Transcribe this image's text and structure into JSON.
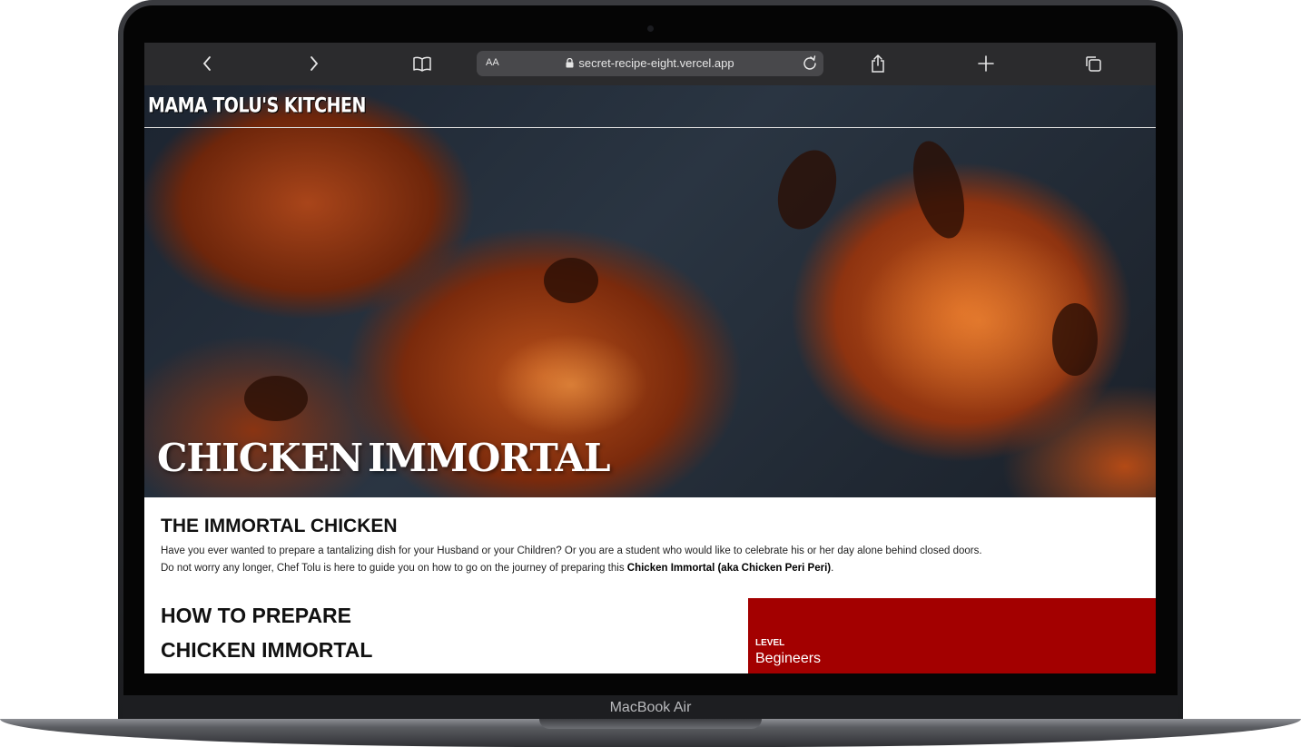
{
  "device": {
    "model_label": "MacBook Air"
  },
  "browser": {
    "text_size_label": "AA",
    "url": "secret-recipe-eight.vercel.app",
    "icons": [
      "back-icon",
      "forward-icon",
      "bookmarks-icon",
      "lock-icon",
      "reload-icon",
      "share-icon",
      "new-tab-icon",
      "tabs-icon"
    ]
  },
  "site": {
    "logo": "MAMA TOLU'S KITCHEN",
    "hero_title_word1": "CHICKEN",
    "hero_title_word2": "IMMORTAL"
  },
  "intro": {
    "heading": "THE IMMORTAL CHICKEN",
    "line1": "Have you ever wanted to prepare a tantalizing dish for your Husband or your Children? Or you are a student who would like to celebrate his or her day alone behind closed doors.",
    "line2": "Do not worry any longer, Chef Tolu is here to guide you on how to go on the journey of preparing this ",
    "highlight": "Chicken Immortal (aka Chicken Peri Peri)",
    "period": "."
  },
  "howto": {
    "line1": "HOW TO PREPARE",
    "line2": "CHICKEN IMMORTAL"
  },
  "level": {
    "label": "LEVEL",
    "value": "Begineers"
  },
  "colors": {
    "accent": "#a30000",
    "toolbar": "#2b2b2d"
  }
}
